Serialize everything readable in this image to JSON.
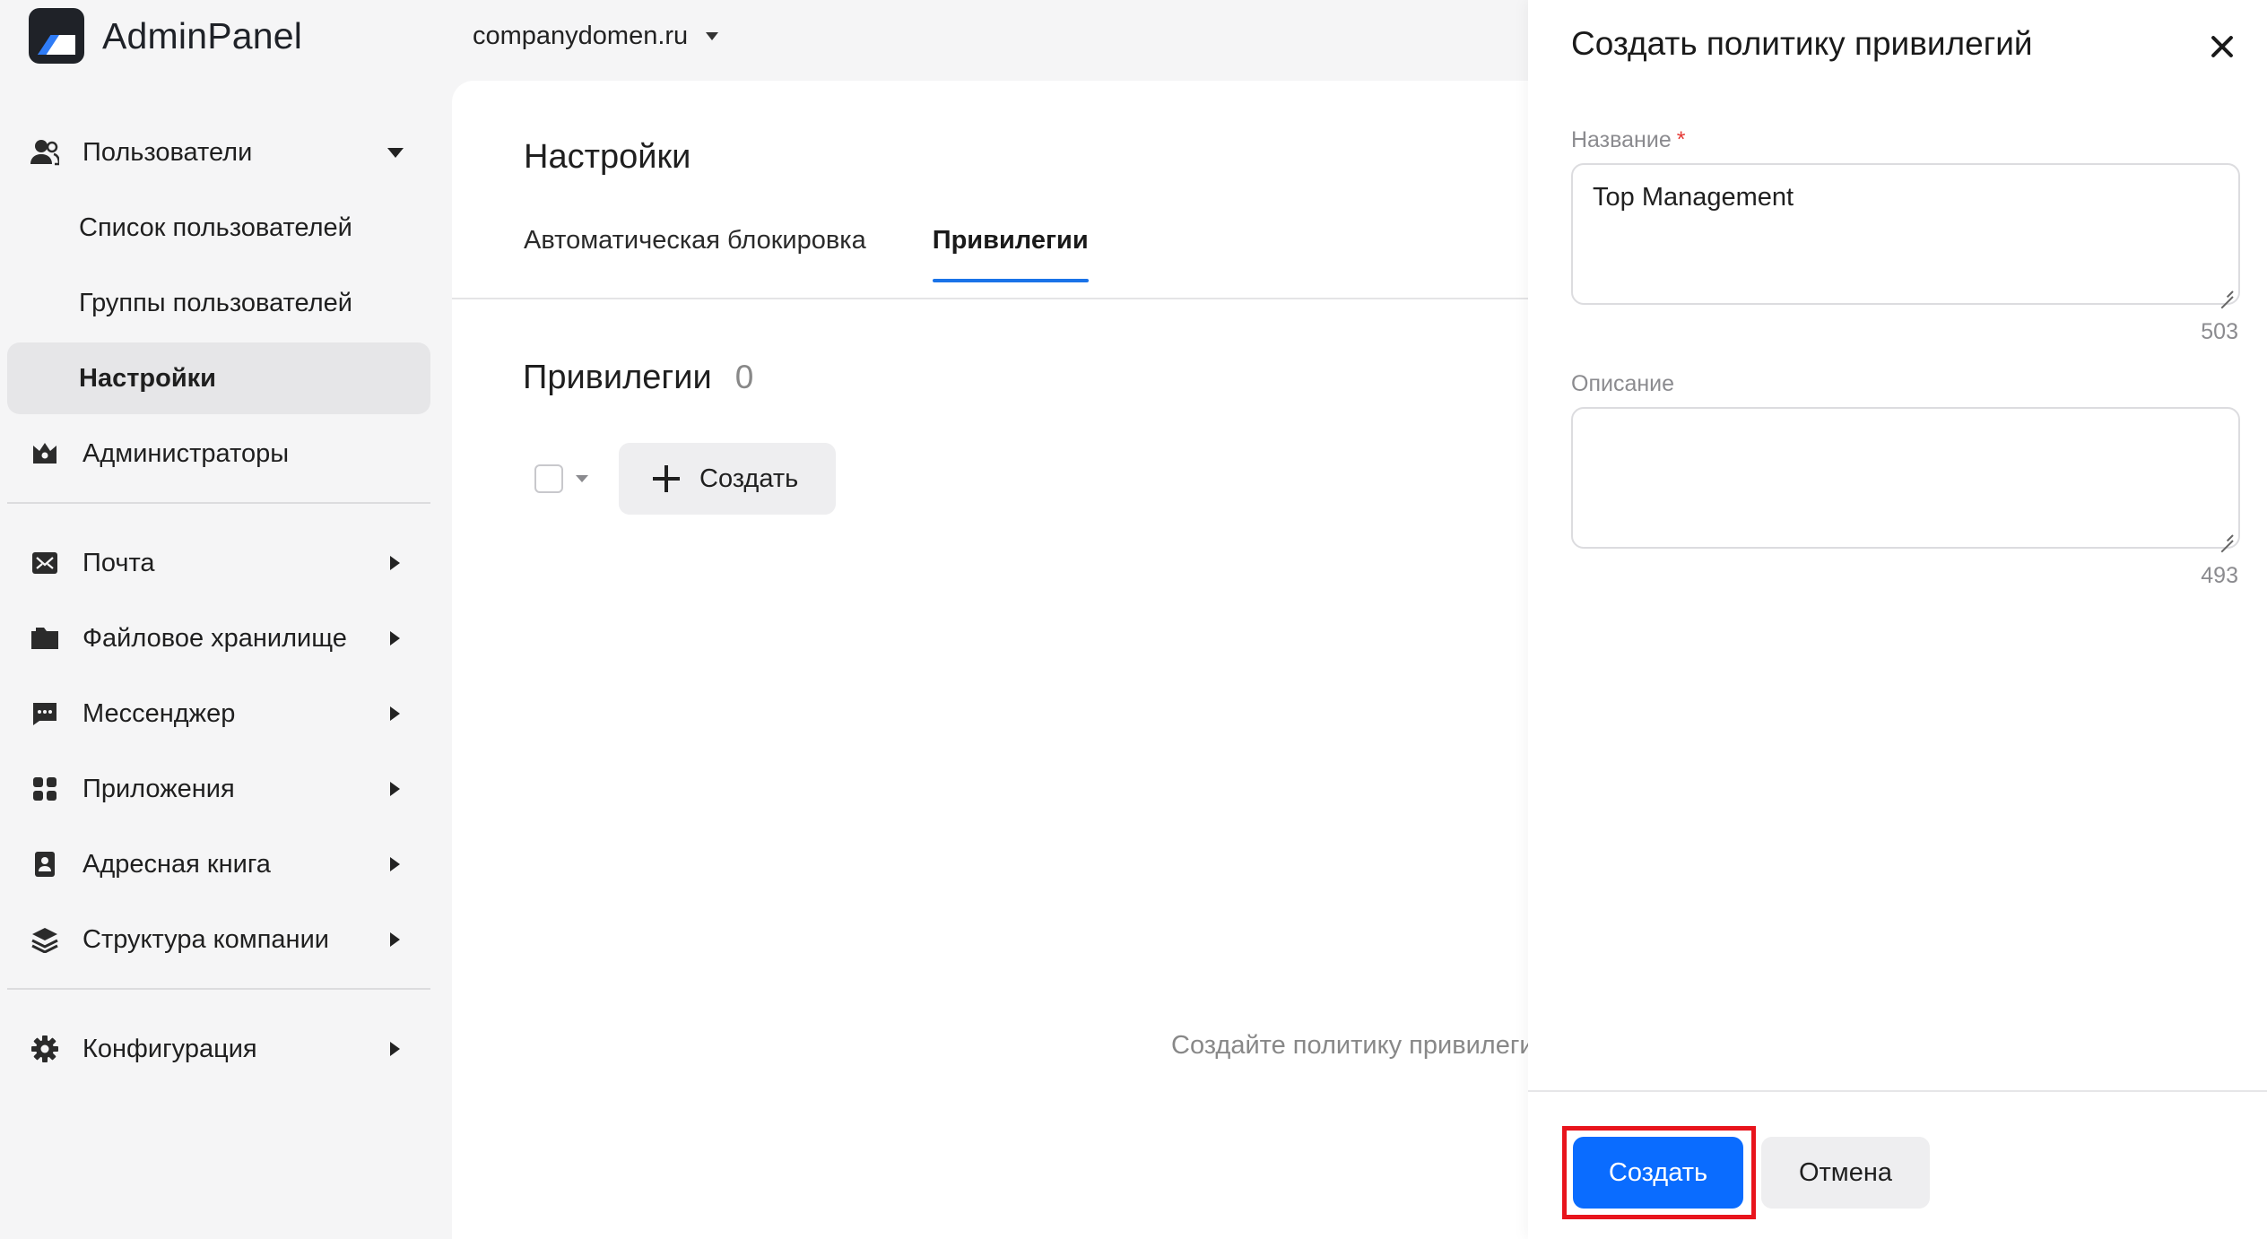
{
  "app": {
    "name": "AdminPanel",
    "domain": "companydomen.ru"
  },
  "sidebar": {
    "users": {
      "label": "Пользователи"
    },
    "users_sub": [
      {
        "label": "Список пользователей"
      },
      {
        "label": "Группы пользователей"
      },
      {
        "label": "Настройки"
      }
    ],
    "admins": {
      "label": "Администраторы"
    },
    "sections": [
      {
        "label": "Почта"
      },
      {
        "label": "Файловое хранилище"
      },
      {
        "label": "Мессенджер"
      },
      {
        "label": "Приложения"
      },
      {
        "label": "Адресная книга"
      },
      {
        "label": "Структура компании"
      }
    ],
    "config": {
      "label": "Конфигурация"
    },
    "active_item": "Настройки"
  },
  "main": {
    "title": "Настройки",
    "tabs": [
      {
        "label": "Автоматическая блокировка",
        "active": false
      },
      {
        "label": "Привилегии",
        "active": true
      }
    ],
    "section": {
      "title": "Привилегии",
      "count": "0"
    },
    "create_label": "Создать",
    "empty_text": "Создайте политику привилегий"
  },
  "drawer": {
    "title": "Создать политику привилегий",
    "name_field": {
      "label": "Название",
      "required_mark": "*",
      "value": "Top Management",
      "counter": "503"
    },
    "description_field": {
      "label": "Описание",
      "value": "",
      "counter": "493"
    },
    "primary_label": "Создать",
    "secondary_label": "Отмена"
  },
  "colors": {
    "accent": "#0a6cff",
    "tab_underline": "#1a73e8",
    "highlight": "#e8141c",
    "required": "#e53935"
  }
}
